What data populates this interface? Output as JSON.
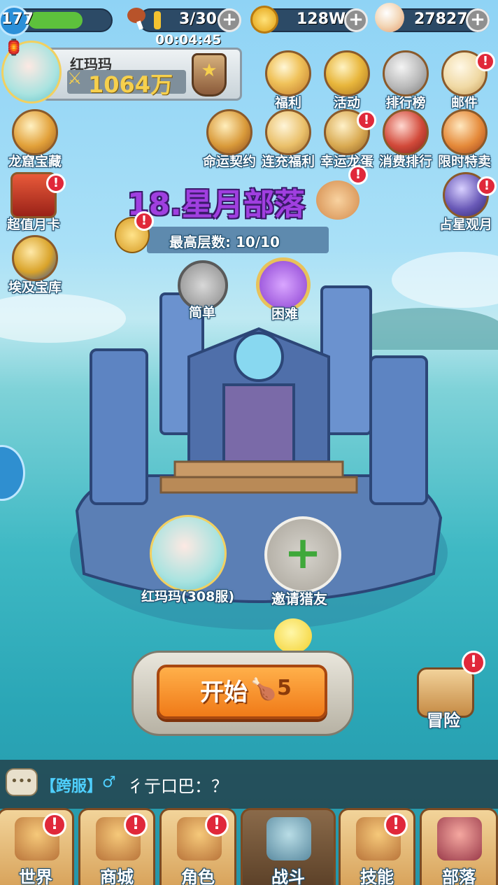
{
  "status": {
    "level": "177",
    "stamina": "3/30",
    "timer": "00:04:45",
    "gold": "128W",
    "gems": "27827"
  },
  "player": {
    "name": "红玛玛",
    "power": "1064万"
  },
  "top_menu": [
    {
      "label": "福利",
      "alert": false
    },
    {
      "label": "活动",
      "alert": false
    },
    {
      "label": "排行榜",
      "alert": false
    },
    {
      "label": "邮件",
      "alert": true
    }
  ],
  "second_menu": [
    {
      "label": "命运契约",
      "alert": false
    },
    {
      "label": "连充福利",
      "alert": false
    },
    {
      "label": "幸运龙蛋",
      "alert": true
    },
    {
      "label": "消费排行",
      "alert": false
    },
    {
      "label": "限时特卖",
      "alert": false
    }
  ],
  "left_menu": [
    {
      "label": "龙窟宝藏",
      "alert": false
    },
    {
      "label": "超值月卡",
      "alert": true
    },
    {
      "label": "埃及宝库",
      "alert": false
    }
  ],
  "right_menu": {
    "stargazing": "占星观月",
    "adventure": "冒险"
  },
  "stage": {
    "title": "18.星月部落",
    "max_floor": "最高层数: 10/10",
    "easy": "简单",
    "hard": "困难"
  },
  "party": {
    "member_name": "红玛玛(308服)",
    "invite": "邀请猎友"
  },
  "start": {
    "label": "开始",
    "cost": "5"
  },
  "chat": {
    "channel": "【跨服】",
    "gender": "♂",
    "message": "彳亍口巴：？"
  },
  "tabs": [
    {
      "label": "世界",
      "alert": true
    },
    {
      "label": "商城",
      "alert": true
    },
    {
      "label": "角色",
      "alert": true
    },
    {
      "label": "战斗",
      "alert": false
    },
    {
      "label": "技能",
      "alert": true
    },
    {
      "label": "部落",
      "alert": false
    }
  ],
  "colors": {
    "accent_orange": "#f08a24",
    "alert_red": "#e0283a",
    "title_purple": "#8a3fd1",
    "sea": "#3fb9c4"
  }
}
